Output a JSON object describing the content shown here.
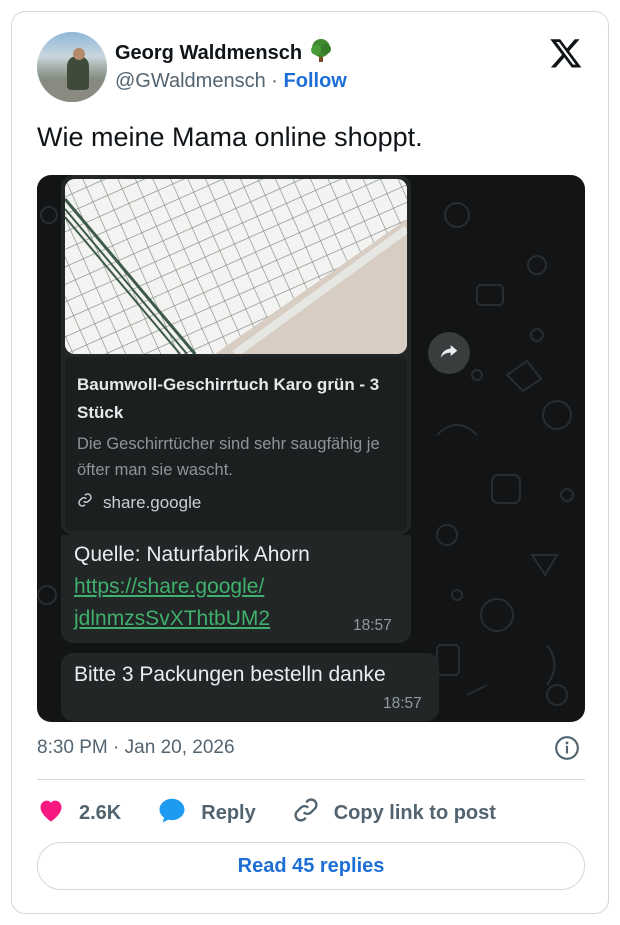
{
  "author": {
    "name": "Georg Waldmensch",
    "name_emoji": "tree-emoji",
    "handle": "@GWaldmensch",
    "separator": "·",
    "follow_label": "Follow"
  },
  "tweet": {
    "text": "Wie meine Mama online shoppt.",
    "time": "8:30 PM",
    "date_separator": "·",
    "date": "Jan 20, 2026"
  },
  "chat": {
    "link_preview": {
      "title": "Baumwoll-Geschirrtuch Karo grün - 3 Stück",
      "description": "Die Geschirrtücher sind sehr saugfähig je öfter man sie wascht.",
      "domain": "share.google"
    },
    "message_1": {
      "line1": "Quelle: Naturfabrik Ahorn",
      "link_line1": "https://share.google/",
      "link_line2": "jdlnmzsSvXThtbUM2",
      "time": "18:57"
    },
    "message_2": {
      "text": "Bitte 3 Packungen bestelln danke",
      "time": "18:57"
    }
  },
  "actions": {
    "likes_count": "2.6K",
    "reply_label": "Reply",
    "copy_label": "Copy link to post"
  },
  "read_replies_label": "Read 45 replies",
  "colors": {
    "brand_blue": "#1d6fd6",
    "like_pink": "#f91880",
    "reply_blue": "#1d9bf0",
    "chat_bg": "#121416",
    "bubble_bg": "#232626",
    "link_green": "#3fb06d"
  }
}
